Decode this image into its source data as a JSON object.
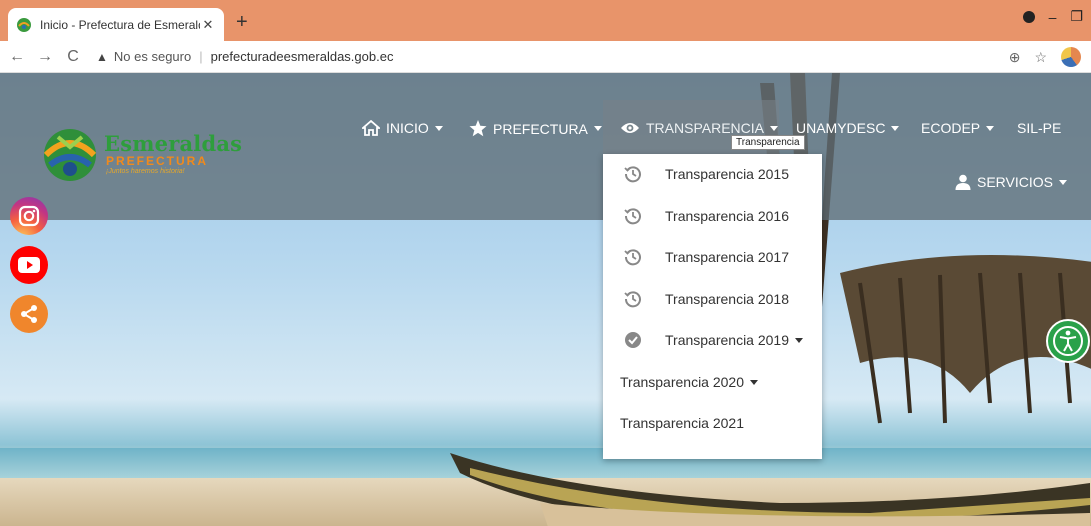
{
  "browser": {
    "tab_title": "Inicio - Prefectura de Esmeraldas",
    "tab_close": "✕",
    "new_tab": "+",
    "back": "←",
    "forward": "→",
    "reload": "C",
    "security_icon": "▲",
    "security_label": "No es seguro",
    "separator": "|",
    "url": "prefecturadeesmeraldas.gob.ec",
    "zoom_icon": "⊕",
    "bookmark_icon": "☆",
    "minimize": "–",
    "restore": "❐"
  },
  "logo": {
    "name": "Esmeraldas",
    "subtitle": "PREFECTURA",
    "slogan": "¡Juntos haremos historia!"
  },
  "nav": {
    "inicio": "INICIO",
    "prefectura": "PREFECTURA",
    "transparencia": "TRANSPARENCIA",
    "unamydesc": "UNAMYDESC",
    "ecodep": "ECODEP",
    "silpe": "SIL-PE",
    "servicios": "SERVICIOS"
  },
  "tooltip": "Transparencia",
  "dropdown": {
    "items": [
      {
        "label": "Transparencia 2015",
        "icon": "history-icon",
        "submenu": false
      },
      {
        "label": "Transparencia 2016",
        "icon": "history-icon",
        "submenu": false
      },
      {
        "label": "Transparencia 2017",
        "icon": "history-icon",
        "submenu": false
      },
      {
        "label": "Transparencia 2018",
        "icon": "history-icon",
        "submenu": false
      },
      {
        "label": "Transparencia 2019",
        "icon": "check-circle-icon",
        "submenu": true
      },
      {
        "label": "Transparencia 2020",
        "icon": "",
        "submenu": true
      },
      {
        "label": "Transparencia 2021",
        "icon": "",
        "submenu": false
      }
    ]
  },
  "colors": {
    "tabbar": "#e8946a",
    "header_overlay": "#606e76",
    "logo_green": "#2e9e3c",
    "logo_orange": "#f08a1c",
    "instagram": "#c13584",
    "youtube": "#ff0000",
    "share": "#f0862c",
    "accessibility": "#2aa14a"
  }
}
